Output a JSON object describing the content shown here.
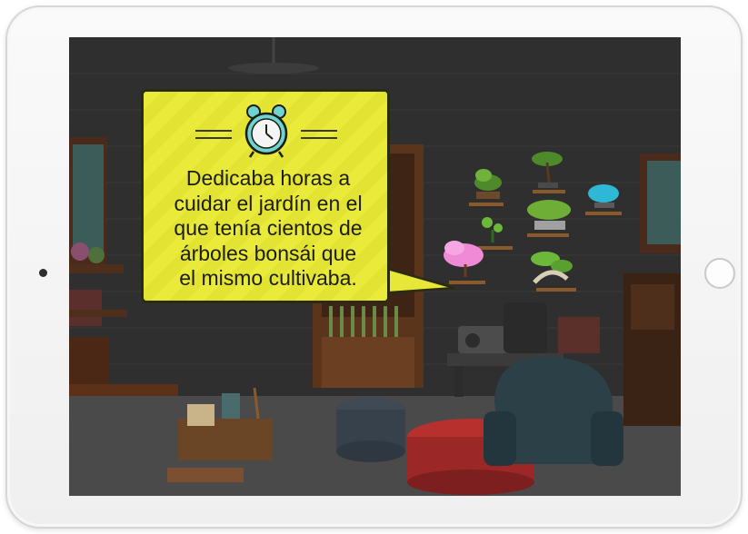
{
  "story": {
    "narration_lines": "Dedicaba horas a\ncuidar el jardín en el\nque tenía cientos de\nárboles bonsái que\nel mismo cultivaba."
  },
  "icons": {
    "narration": "alarm-clock-icon",
    "camera": "front-camera-icon",
    "home": "home-button-icon"
  },
  "colors": {
    "bubble_fill": "#e6e737",
    "bubble_border": "#2b2b10",
    "scene_wall": "#2f2f2f",
    "blossom": "#f08ad6",
    "clock_face": "#6fd3d1"
  }
}
